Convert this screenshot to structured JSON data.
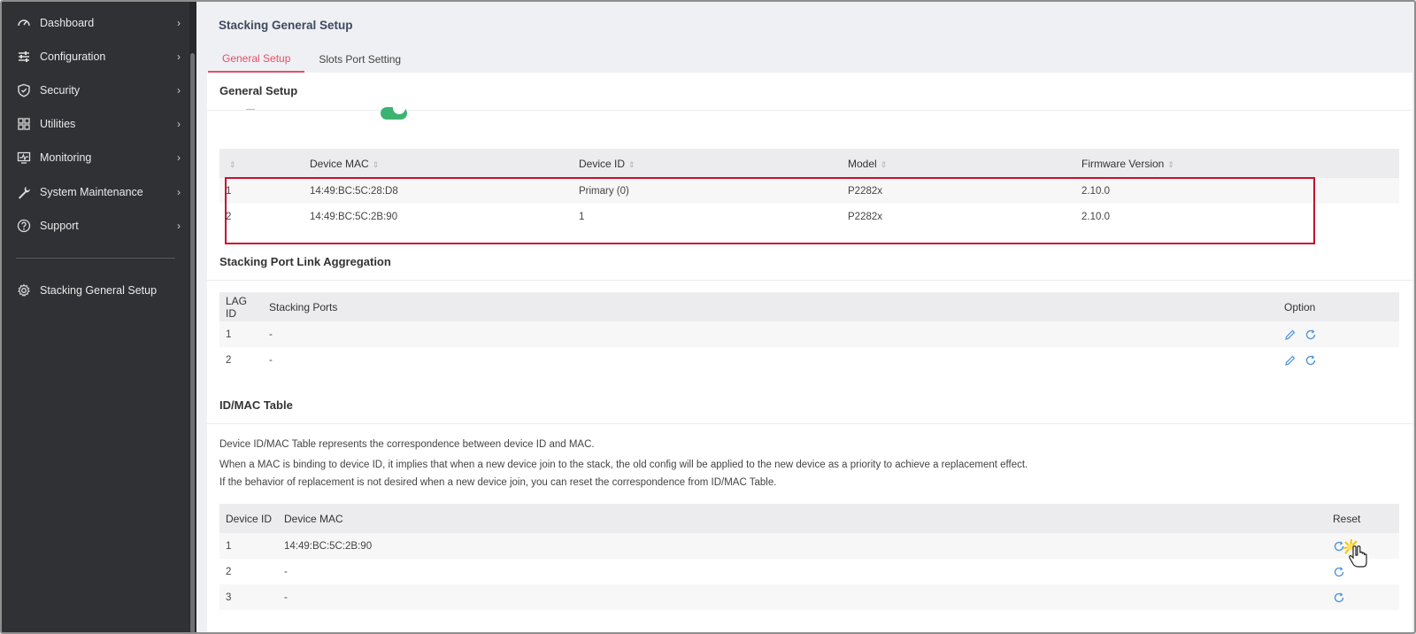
{
  "sidebar": {
    "items": [
      {
        "label": "Dashboard",
        "icon": "speedometer-icon"
      },
      {
        "label": "Configuration",
        "icon": "sliders-icon"
      },
      {
        "label": "Security",
        "icon": "shield-icon"
      },
      {
        "label": "Utilities",
        "icon": "grid-icon"
      },
      {
        "label": "Monitoring",
        "icon": "monitor-icon"
      },
      {
        "label": "System Maintenance",
        "icon": "wrench-icon"
      },
      {
        "label": "Support",
        "icon": "help-icon"
      }
    ],
    "current": {
      "label": "Stacking General Setup",
      "icon": "gear-icon"
    }
  },
  "page": {
    "title": "Stacking General Setup",
    "tabs": [
      {
        "label": "General Setup",
        "active": true
      },
      {
        "label": "Slots Port Setting",
        "active": false
      }
    ]
  },
  "general_setup": {
    "title": "General Setup",
    "toggle_on": true,
    "headers": [
      "",
      "Device MAC",
      "Device ID",
      "Model",
      "Firmware Version"
    ],
    "rows": [
      {
        "idx": "1",
        "mac": "14:49:BC:5C:28:D8",
        "device_id": "Primary (0)",
        "model": "P2282x",
        "firmware": "2.10.0"
      },
      {
        "idx": "2",
        "mac": "14:49:BC:5C:2B:90",
        "device_id": "1",
        "model": "P2282x",
        "firmware": "2.10.0"
      }
    ]
  },
  "lag": {
    "title": "Stacking Port Link Aggregation",
    "headers": [
      "LAG ID",
      "Stacking Ports",
      "Option"
    ],
    "rows": [
      {
        "id": "1",
        "ports": "-"
      },
      {
        "id": "2",
        "ports": "-"
      }
    ]
  },
  "idmac": {
    "title": "ID/MAC Table",
    "desc1": "Device ID/MAC Table represents the correspondence between device ID and MAC.",
    "desc2": "When a MAC is binding to device ID, it implies that when a new device join to the stack, the old config will be applied to the new device as a priority to achieve a replacement effect.",
    "desc3": "If the behavior of replacement is not desired when a new device join, you can reset the correspondence from ID/MAC Table.",
    "headers": [
      "Device ID",
      "Device MAC",
      "Reset"
    ],
    "rows": [
      {
        "id": "1",
        "mac": "14:49:BC:5C:2B:90"
      },
      {
        "id": "2",
        "mac": "-"
      },
      {
        "id": "3",
        "mac": "-"
      }
    ]
  },
  "colors": {
    "accent": "#e2506a",
    "sidebar_bg": "#2f3135",
    "toggle_on": "#3cb371",
    "action_icon": "#4a90d9",
    "highlight": "#c8102e"
  }
}
